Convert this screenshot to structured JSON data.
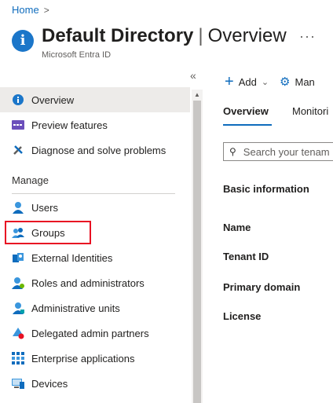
{
  "breadcrumb": {
    "home": "Home",
    "separator": ">"
  },
  "header": {
    "icon": "info-icon",
    "icon_glyph": "i",
    "title_bold": "Default Directory",
    "title_sep": "|",
    "title_rest": "Overview",
    "subtitle": "Microsoft Entra ID",
    "more": "···"
  },
  "sidebar": {
    "collapse_glyph": "«",
    "top_items": [
      {
        "label": "Overview",
        "icon": "info-icon",
        "selected": true
      },
      {
        "label": "Preview features",
        "icon": "preview-features-icon"
      },
      {
        "label": "Diagnose and solve problems",
        "icon": "wrench-icon"
      }
    ],
    "section_label": "Manage",
    "manage_items": [
      {
        "label": "Users",
        "icon": "user-icon"
      },
      {
        "label": "Groups",
        "icon": "groups-icon"
      },
      {
        "label": "External Identities",
        "icon": "external-identities-icon"
      },
      {
        "label": "Roles and administrators",
        "icon": "roles-icon"
      },
      {
        "label": "Administrative units",
        "icon": "administrative-units-icon"
      },
      {
        "label": "Delegated admin partners",
        "icon": "delegated-partners-icon"
      },
      {
        "label": "Enterprise applications",
        "icon": "enterprise-apps-icon"
      },
      {
        "label": "Devices",
        "icon": "devices-icon"
      }
    ]
  },
  "toolbar": {
    "add_label": "Add",
    "manage_label": "Man"
  },
  "tabs": [
    {
      "label": "Overview",
      "active": true
    },
    {
      "label": "Monitori"
    }
  ],
  "search": {
    "placeholder": "Search your tenam"
  },
  "main": {
    "section_title": "Basic information",
    "fields": [
      "Name",
      "Tenant ID",
      "Primary domain",
      "License"
    ]
  },
  "colors": {
    "accent": "#0f6cbd",
    "highlight_border": "#e81123",
    "selected_bg": "#edebe9"
  }
}
